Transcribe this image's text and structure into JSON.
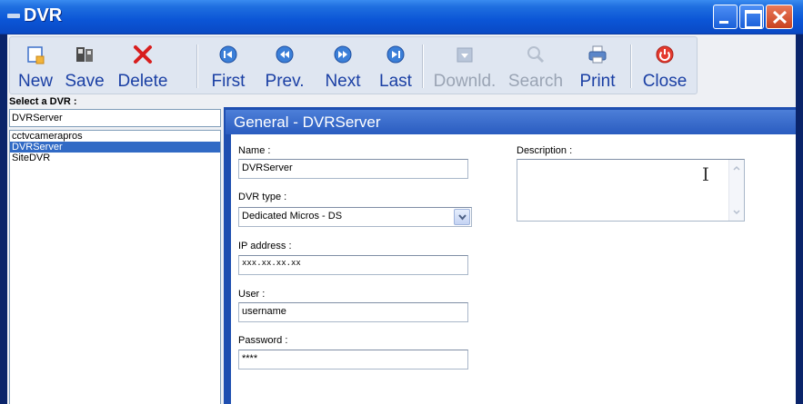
{
  "window": {
    "title": "DVR"
  },
  "toolbar": {
    "new": "New",
    "save": "Save",
    "delete": "Delete",
    "first": "First",
    "prev": "Prev.",
    "next": "Next",
    "last": "Last",
    "download": "Downld.",
    "search": "Search",
    "print": "Print",
    "close": "Close"
  },
  "sidebar": {
    "select_label": "Select a DVR :",
    "selected_value": "DVRServer",
    "items": [
      "cctvcamerapros",
      "DVRServer",
      "SiteDVR"
    ],
    "selected_index": 1
  },
  "form": {
    "header": "General - DVRServer",
    "name_label": "Name :",
    "name_value": "DVRServer",
    "dvr_type_label": "DVR type  :",
    "dvr_type_value": "Dedicated Micros - DS",
    "ip_label": "IP address :",
    "ip_value": "xxx.xx.xx.xx",
    "user_label": "User :",
    "user_value": "username",
    "password_label": "Password :",
    "password_value": "****",
    "description_label": "Description :",
    "description_value": ""
  },
  "colors": {
    "titlebar": "#0b55d6",
    "toolbar_text": "#1a3fa4",
    "selection": "#316ac5",
    "form_header": "#2a5cc0"
  }
}
